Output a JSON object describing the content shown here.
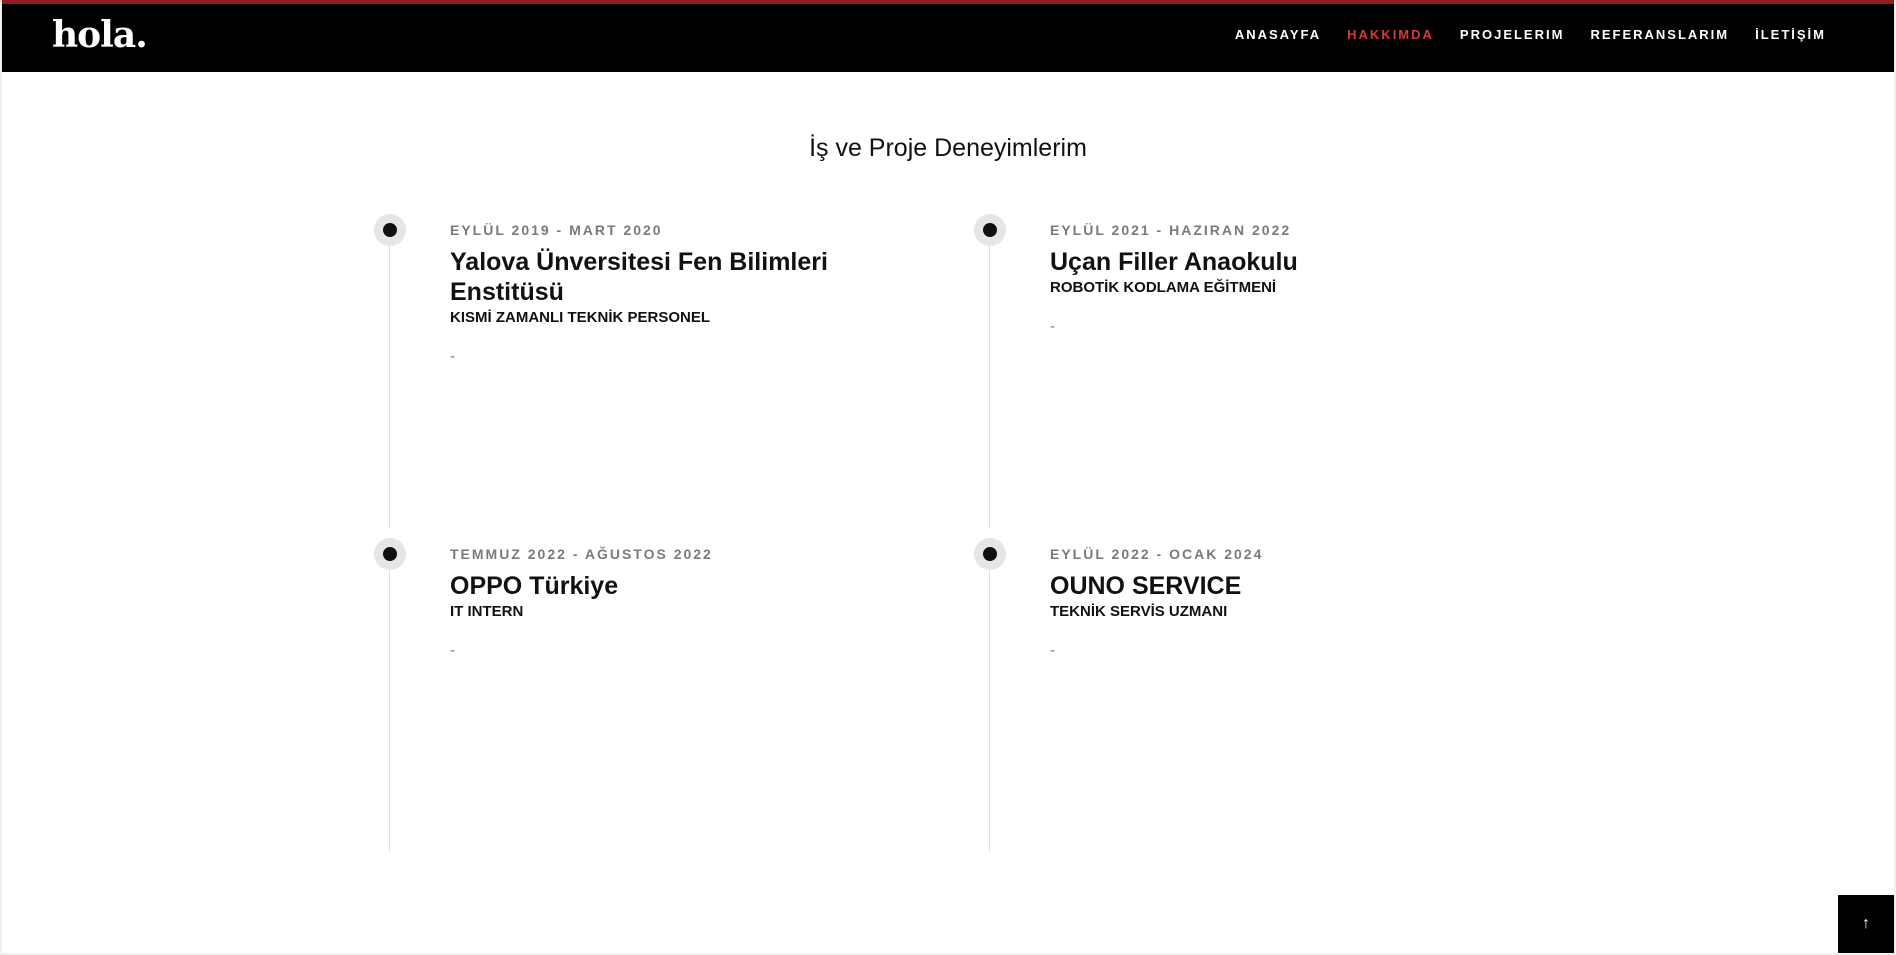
{
  "header": {
    "logo": "hola.",
    "nav": [
      {
        "label": "ANASAYFA"
      },
      {
        "label": "HAKKIMDA"
      },
      {
        "label": "PROJELERIM"
      },
      {
        "label": "REFERANSLARIM"
      },
      {
        "label": "İLETİŞİM"
      }
    ],
    "active_nav": "HAKKIMDA"
  },
  "section": {
    "title": "İş ve Proje Deneyimlerim"
  },
  "timeline": [
    {
      "date": "EYLÜL 2019 - MART 2020",
      "company": "Yalova Ünversitesi Fen Bilimleri Enstitüsü",
      "role": "KISMİ ZAMANLI TEKNİK PERSONEL",
      "description": "-"
    },
    {
      "date": "EYLÜL 2021 - HAZIRAN 2022",
      "company": "Uçan Filler Anaokulu",
      "role": "ROBOTİK KODLAMA EĞİTMENİ",
      "description": "-"
    },
    {
      "date": "TEMMUZ 2022 - AĞUSTOS 2022",
      "company": "OPPO Türkiye",
      "role": "IT INTERN",
      "description": "-"
    },
    {
      "date": "EYLÜL 2022 - OCAK 2024",
      "company": "OUNO SERVICE",
      "role": "TEKNİK SERVİS UZMANI",
      "description": "-"
    }
  ],
  "scroll_top": {
    "icon": "arrow-up-icon",
    "glyph": "↑"
  },
  "colors": {
    "header_bg": "#000000",
    "accent": "#d23a3a",
    "top_border": "#8f1d1d",
    "date_text": "#7a7a7a"
  }
}
